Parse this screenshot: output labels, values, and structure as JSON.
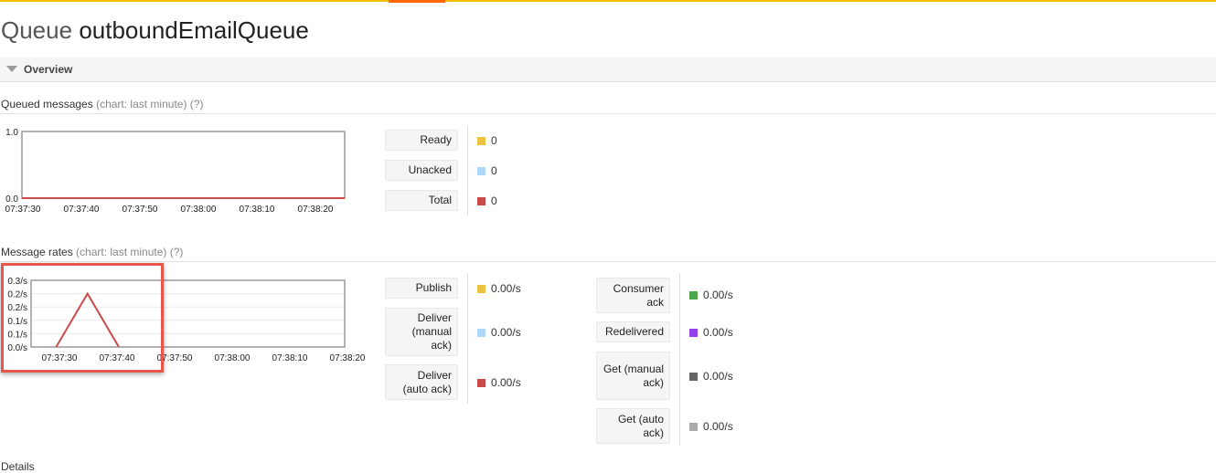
{
  "page": {
    "title_prefix": "Queue",
    "queue_name": "outboundEmailQueue"
  },
  "overview": {
    "label": "Overview"
  },
  "queued": {
    "heading": "Queued messages",
    "chart_note": "(chart: last minute)",
    "help": "(?)",
    "rows": [
      {
        "label": "Ready",
        "value": "0",
        "color": "#edc240"
      },
      {
        "label": "Unacked",
        "value": "0",
        "color": "#afd8f8"
      },
      {
        "label": "Total",
        "value": "0",
        "color": "#cb4b4b"
      }
    ]
  },
  "rates": {
    "heading": "Message rates",
    "chart_note": "(chart: last minute)",
    "help": "(?)",
    "left_rows": [
      {
        "label": "Publish",
        "value": "0.00/s",
        "color": "#edc240"
      },
      {
        "label": "Deliver (manual ack)",
        "value": "0.00/s",
        "color": "#afd8f8"
      },
      {
        "label": "Deliver (auto ack)",
        "value": "0.00/s",
        "color": "#cb4b4b"
      }
    ],
    "right_rows": [
      {
        "label": "Consumer ack",
        "value": "0.00/s",
        "color": "#4da74d"
      },
      {
        "label": "Redelivered",
        "value": "0.00/s",
        "color": "#9440ed"
      },
      {
        "label": "Get (manual ack)",
        "value": "0.00/s",
        "color": "#666666"
      },
      {
        "label": "Get (auto ack)",
        "value": "0.00/s",
        "color": "#aaaaaa"
      }
    ]
  },
  "details": {
    "heading": "Details"
  },
  "chart_data": [
    {
      "type": "line",
      "y_tick_labels": [
        "1.0",
        "0.0"
      ],
      "x_tick_labels": [
        "07:37:30",
        "07:37:40",
        "07:37:50",
        "07:38:00",
        "07:38:10",
        "07:38:20"
      ],
      "ylim": [
        0,
        1
      ],
      "grid": false,
      "series": [
        {
          "color": "#cb4b4b",
          "points": [
            [
              0,
              0
            ],
            [
              1,
              0
            ]
          ]
        }
      ]
    },
    {
      "type": "line",
      "y_tick_labels": [
        "0.3/s",
        "0.2/s",
        "0.2/s",
        "0.1/s",
        "0.1/s",
        "0.0/s"
      ],
      "x_tick_labels": [
        "07:37:30",
        "07:37:40",
        "07:37:50",
        "07:38:00",
        "07:38:10",
        "07:38:20"
      ],
      "ylim": [
        0,
        0.25
      ],
      "grid": true,
      "series": [
        {
          "color": "#cb4b4b",
          "points": [
            [
              0.08,
              0
            ],
            [
              0.18,
              0.2
            ],
            [
              0.28,
              0
            ]
          ]
        }
      ]
    }
  ]
}
